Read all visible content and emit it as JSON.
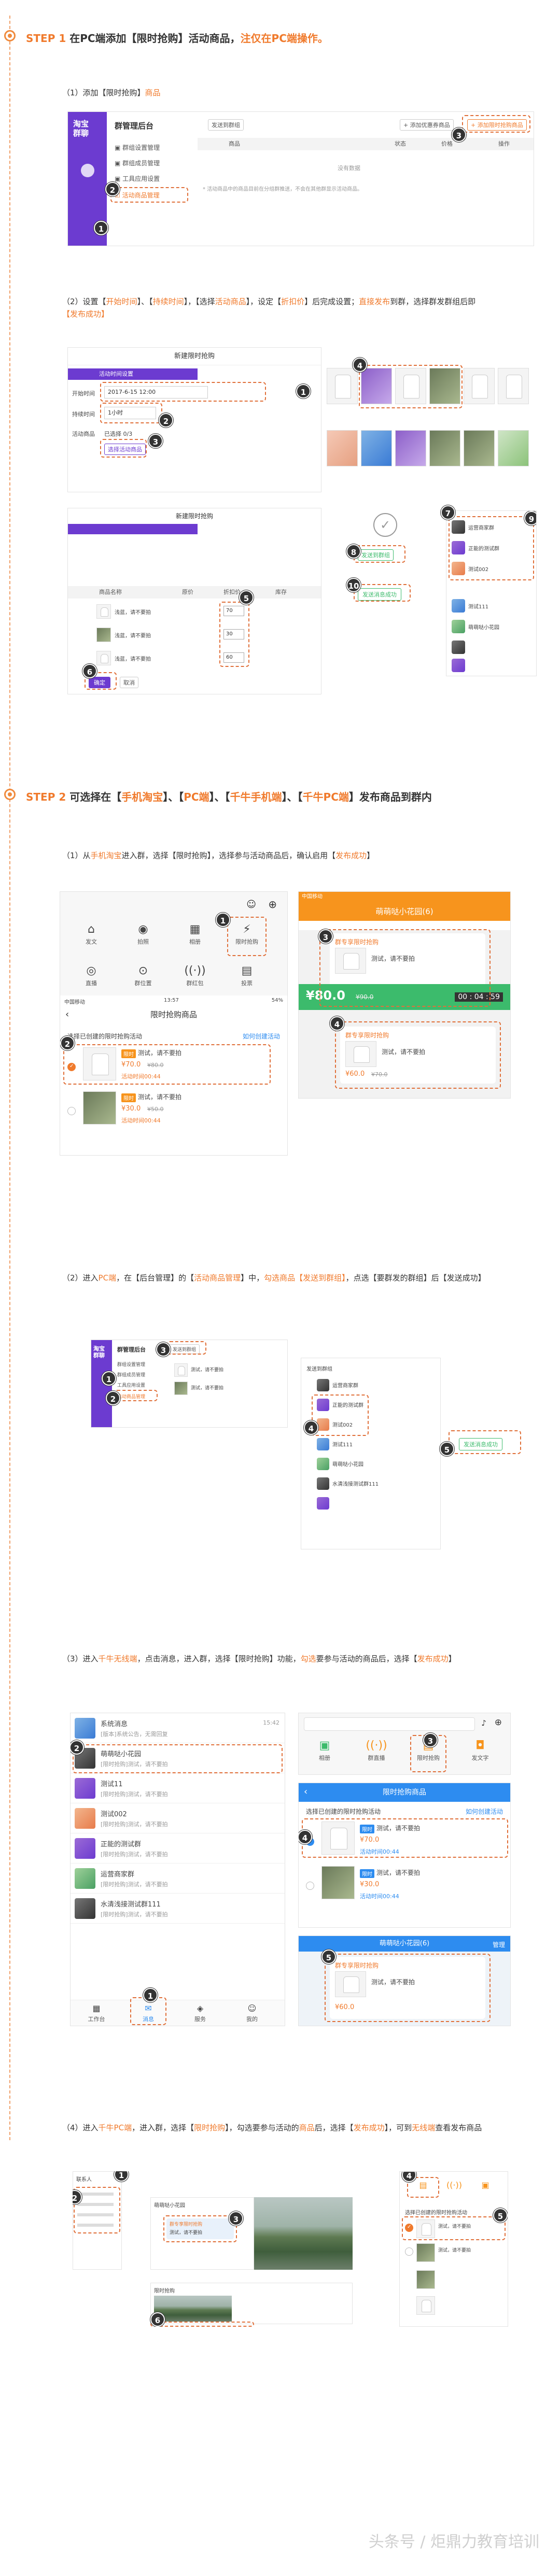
{
  "step1": {
    "label": "STEP 1",
    "title_a": " 在PC端添加【限时抢购】活动商品，",
    "title_b": "注仅在PC端操作。",
    "sub1_a": "（1）添加【限时抢购】",
    "sub1_b": "商品",
    "sub2_a": "（2）设置【",
    "sub2_b": "开始时间",
    "sub2_c": "】、【",
    "sub2_d": "持续时间",
    "sub2_e": "】，【选择",
    "sub2_f": "活动商品",
    "sub2_g": "】，设定【",
    "sub2_h": "折扣价",
    "sub2_i": "】后完成设置；",
    "sub2_j": "直接发布",
    "sub2_k": "到群，选择群发群组后即",
    "sub2_l": "【发布成功】"
  },
  "step2": {
    "label": "STEP 2",
    "title_a": " 可选择在【",
    "t_mobile": "手机淘宝",
    "title_b": "】、【",
    "t_pc": "PC端",
    "title_c": "】、【",
    "t_qnm": "千牛手机端",
    "title_d": "】、【",
    "t_qnpc": "千牛PC端",
    "title_e": "】发布商品到群内",
    "sub1_a": "（1）从",
    "sub1_b": "手机淘宝",
    "sub1_c": "进入群，选择【限时抢购】，选择参与活动商品后，确认启用【",
    "sub1_d": "发布成功",
    "sub1_e": "】",
    "sub2_a": "（2）进入",
    "sub2_b": "PC端",
    "sub2_c": "，在【后台管理】的【",
    "sub2_d": "活动商品管理",
    "sub2_e": "】中，",
    "sub2_f": "勾选商品【发送到群组】",
    "sub2_g": "，点选【要群发的群组】后【发送成功】",
    "sub3_a": "（3）进入",
    "sub3_b": "千牛无线端",
    "sub3_c": "，点击消息，进入群，选择【限时抢购】功能，",
    "sub3_d": "勾选",
    "sub3_e": "要参与活动的商品后，选择【",
    "sub3_f": "发布成功",
    "sub3_g": "】",
    "sub4_a": "（4）进入",
    "sub4_b": "千牛PC端",
    "sub4_c": "，进入群，选择【",
    "sub4_d": "限时抢购",
    "sub4_e": "】，勾选要参与活动的",
    "sub4_f": "商品",
    "sub4_g": "后，选择【",
    "sub4_h": "发布成功",
    "sub4_i": "】，可到",
    "sub4_j": "无线端",
    "sub4_k": "查看发布商品"
  },
  "pc": {
    "logo_line1": "淘宝",
    "logo_line2": "群聊",
    "admin_title": "群管理后台",
    "menu_group": "群组设置管理",
    "menu_members": "群组成员管理",
    "menu_tools": "工具应用设置",
    "menu_active": "活动商品管理",
    "tab_send": "发送到群组",
    "btn_add": "+ 添加限时抢购商品",
    "btn_add_timed": "+ 添加优惠券商品",
    "col_goods": "商品",
    "col_status": "状态",
    "col_price": "价格",
    "col_op": "操作",
    "empty": "没有数据",
    "notice": "* 活动商品中的商品目前在分组群推送，不会在其他群显示活动商品。"
  },
  "form": {
    "title": "新建限时抢购",
    "section": "活动时间设置",
    "start_label": "开始时间",
    "start_value": "2017-6-15  12:00",
    "dur_label": "持续时间",
    "dur_value": "1小时",
    "goods_label": "活动商品",
    "goods_value": "已选择 0/3",
    "choose_btn": "选择活动商品",
    "title2": "新建限时抢购",
    "col_name": "商品名称",
    "col_price": "原价",
    "col_discount": "折扣价",
    "col_stock": "库存",
    "item_name": "浅蓝，请不要拍",
    "price1": "70",
    "price2": "30",
    "price3": "60",
    "btn_ok": "确定",
    "btn_cancel": "取消",
    "send_btn": "发送到群组",
    "send_success": "发送消息成功"
  },
  "publish": {
    "group1": "运营商家群",
    "group2": "正能的测试群",
    "group3": "测试002",
    "group4": "测试111",
    "group5": "萌萌哒小花园",
    "send": "发送到群组"
  },
  "mobile": {
    "func1": "发文",
    "func2": "拍照",
    "func3": "相册",
    "func4": "限时抢购",
    "func5": "直播",
    "func6": "群位置",
    "func7": "群红包",
    "func8": "投票",
    "status_left": "中国移动",
    "status_time": "13:57",
    "status_right": "54%",
    "list_title": "限时抢购商品",
    "choose_hint": "选择已创建的限时抢购活动",
    "how_create": "如何创建活动",
    "tag_new": "限时",
    "item_desc": "测试，请不要拍",
    "price_a": "¥70.0",
    "old_a": "¥80.0",
    "time_a": "活动时间00:44",
    "price_b": "¥30.0",
    "old_b": "¥50.0",
    "time_b": "活动时间00:44",
    "group_name": "萌萌哒小花园(6)",
    "chat_tag": "群专享限时抢购",
    "chat_desc": "测试，请不要拍",
    "chat_price": "¥80.0",
    "chat_old": "¥90.0",
    "chat_price2": "¥60.0",
    "chat_old2": "¥70.0",
    "timer": "00 : 04 : 59"
  },
  "qn": {
    "sys_msg": "系统消息",
    "sys_desc": "[版本]系统公告，无需回复",
    "sys_time": "15:42",
    "group_a": "萌萌哒小花园",
    "group_a_desc": "[限时抢购]测试，请不要拍",
    "group_b": "测试11",
    "group_c": "测试002",
    "group_d": "正能的测试群",
    "group_e": "运营商家群",
    "group_f": "水清浅接测试群111",
    "tab1": "工作台",
    "tab2": "消息",
    "tab3": "服务",
    "tab4": "我的",
    "tool1": "相册",
    "tool2": "群直播",
    "tool3": "限时抢购",
    "tool4": "发文字",
    "blue_title": "限时抢购商品",
    "blue_group": "萌萌哒小花园(6)",
    "manage": "管理",
    "choose_hint": "选择已创建的限时抢购活动",
    "how": "如何创建活动"
  },
  "qnpc": {
    "contacts": "联系人",
    "chat_head": "萌萌哒小花园",
    "msg1": "群专享限时抢购",
    "msg2": "测试，请不要拍",
    "tip": "限时抢购"
  },
  "watermark": "头条号 / 炬鼎力教育培训"
}
